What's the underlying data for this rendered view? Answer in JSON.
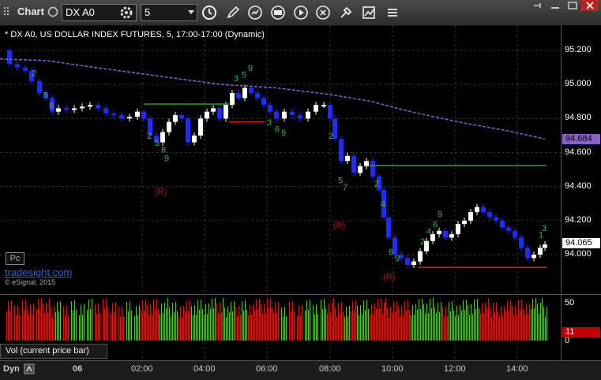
{
  "toolbar": {
    "title": "Chart",
    "symbol": "DX A0",
    "interval": "5",
    "icons": [
      "clock-icon",
      "pencil-icon",
      "refresh-icon",
      "report-icon",
      "play-icon",
      "close-circle-icon",
      "tools-icon",
      "chart-type-icon",
      "menu-icon"
    ]
  },
  "chart": {
    "study_title": "* DX A0, US DOLLAR INDEX FUTURES, 5, 17:00-17:00 (Dynamic)",
    "pc_label": "Pc",
    "watermark": "tradesight.com",
    "copyright": "© eSignal, 2015",
    "price_ticks": [
      "95.200",
      "95.000",
      "94.800",
      "94.600",
      "94.400",
      "94.200",
      "94.000"
    ],
    "current_tag": "94.065",
    "ma_tag": "94.684",
    "reversal_markers": [
      "(R)",
      "(R)",
      "(R)"
    ],
    "colors": {
      "up": "#ffffff",
      "down": "#1f2bff",
      "ma": "#8a5fd0",
      "resistance": "#27a02a",
      "support": "#e01818",
      "count": "#3fb33f",
      "reversal": "#b01414"
    }
  },
  "volume": {
    "label": "Vol (current price bar)",
    "ticks": [
      "50",
      "0"
    ],
    "current_tag": "11"
  },
  "time_axis": {
    "mode": "Dyn",
    "labels": [
      "06",
      "02:00",
      "04:00",
      "06:00",
      "08:00",
      "10:00",
      "12:00",
      "14:00"
    ]
  }
}
